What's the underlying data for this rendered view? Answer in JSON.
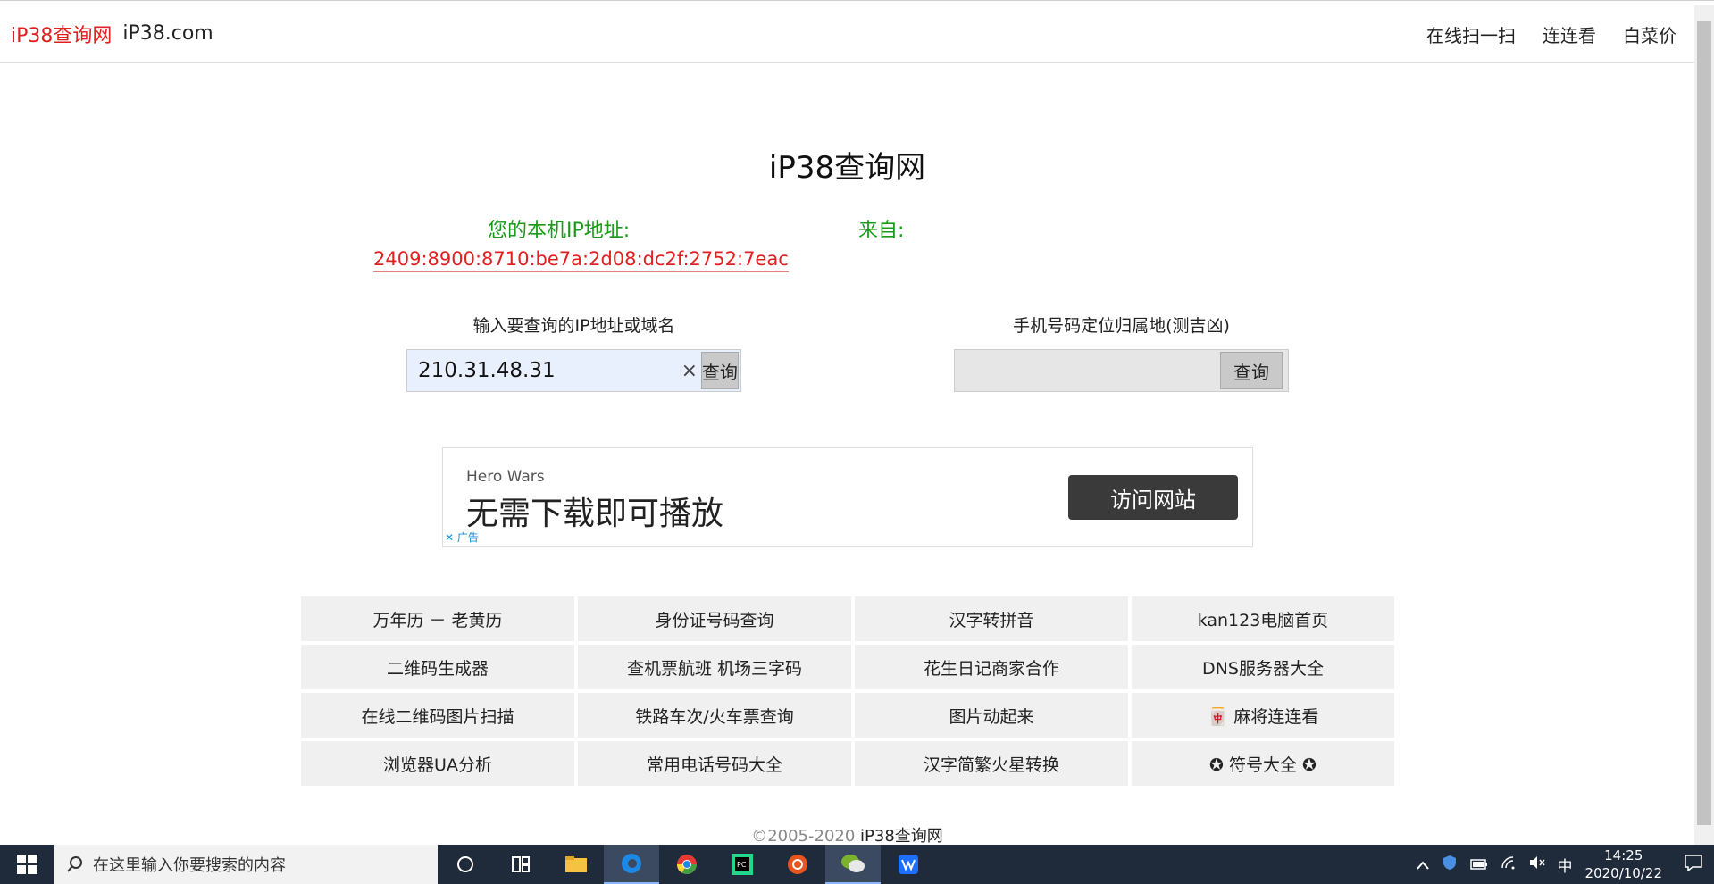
{
  "header": {
    "brand_red": "iP38查询网",
    "brand_domain": "iP38.com",
    "nav": [
      "在线扫一扫",
      "连连看",
      "白菜价"
    ]
  },
  "main": {
    "title": "iP38查询网",
    "ip_label": "您的本机IP地址:",
    "from_label": "来自:",
    "ip_value": "2409:8900:8710:be7a:2d08:dc2f:2752:7eac",
    "ip_query_label": "输入要查询的IP地址或域名",
    "ip_query_value": "210.31.48.31",
    "ip_query_button": "查询",
    "clear_glyph": "×",
    "phone_query_label": "手机号码定位归属地(测吉凶)",
    "phone_query_button": "查询"
  },
  "ad": {
    "brand": "Hero Wars",
    "text": "无需下载即可播放",
    "button": "访问网站",
    "close_label": "✕ 广告"
  },
  "links": [
    "万年历 － 老黄历",
    "身份证号码查询",
    "汉字转拼音",
    "kan123电脑首页",
    "二维码生成器",
    "查机票航班 机场三字码",
    "花生日记商家合作",
    "DNS服务器大全",
    "在线二维码图片扫描",
    "铁路车次/火车票查询",
    "图片动起来",
    "🀄 麻将连连看",
    "浏览器UA分析",
    "常用电话号码大全",
    "汉字简繁火星转换",
    "✪ 符号大全 ✪"
  ],
  "footer": {
    "copyright": "©2005-2020",
    "site": "iP38查询网"
  },
  "taskbar": {
    "search_placeholder": "在这里输入你要搜索的内容",
    "ime": "中",
    "time": "14:25",
    "date": "2020/10/22"
  }
}
